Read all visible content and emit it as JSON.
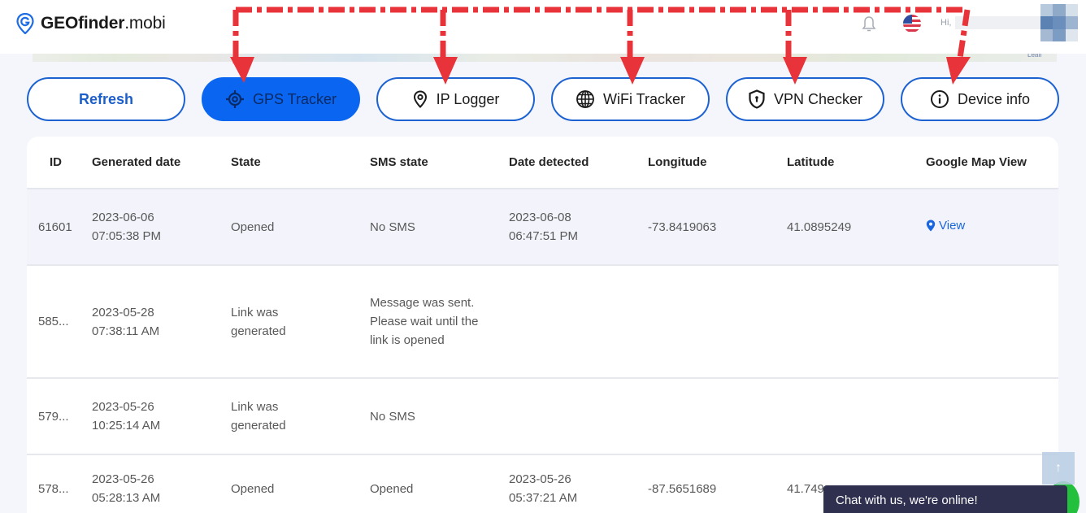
{
  "header": {
    "logo_bold": "GEOfinder",
    "logo_light": ".mobi",
    "greeting": "Hi,",
    "icons": [
      "location-pin-logo-icon",
      "bell-icon",
      "us-flag-icon",
      "avatar"
    ]
  },
  "map_attribution": "Leafl",
  "tabs": [
    {
      "label": "Refresh",
      "icon": null,
      "active": false
    },
    {
      "label": "GPS Tracker",
      "icon": "crosshair-icon",
      "active": true
    },
    {
      "label": "IP Logger",
      "icon": "location-pin-icon",
      "active": false
    },
    {
      "label": "WiFi Tracker",
      "icon": "globe-icon",
      "active": false
    },
    {
      "label": "VPN Checker",
      "icon": "shield-icon",
      "active": false
    },
    {
      "label": "Device info",
      "icon": "info-icon",
      "active": false
    }
  ],
  "table": {
    "columns": [
      "ID",
      "Generated date",
      "State",
      "SMS state",
      "Date detected",
      "Longitude",
      "Latitude",
      "Google Map View"
    ],
    "rows": [
      {
        "id": "61601",
        "generated_date": "2023-06-06",
        "generated_time": "07:05:38 PM",
        "state": "Opened",
        "sms_state": "No SMS",
        "detected_date": "2023-06-08",
        "detected_time": "06:47:51 PM",
        "longitude": "-73.8419063",
        "latitude": "41.0895249",
        "map_view": "View"
      },
      {
        "id": "585...",
        "generated_date": "2023-05-28",
        "generated_time": "07:38:11 AM",
        "state": "Link was generated",
        "sms_state": "Message was sent. Please wait until the link is opened",
        "detected_date": "",
        "detected_time": "",
        "longitude": "",
        "latitude": "",
        "map_view": ""
      },
      {
        "id": "579...",
        "generated_date": "2023-05-26",
        "generated_time": "10:25:14 AM",
        "state": "Link was generated",
        "sms_state": "No SMS",
        "detected_date": "",
        "detected_time": "",
        "longitude": "",
        "latitude": "",
        "map_view": ""
      },
      {
        "id": "578...",
        "generated_date": "2023-05-26",
        "generated_time": "05:28:13 AM",
        "state": "Opened",
        "sms_state": "Opened",
        "detected_date": "2023-05-26",
        "detected_time": "05:37:21 AM",
        "longitude": "-87.5651689",
        "latitude": "41.749",
        "map_view": ""
      }
    ]
  },
  "chat_widget": {
    "text": "Chat with us, we're online!"
  },
  "scroll_top": {
    "icon": "arrow-up-icon",
    "glyph": "↑"
  },
  "colors": {
    "accent": "#0a66f0",
    "border_blue": "#1d62d1",
    "annotation_red": "#e8333a",
    "chat_bg": "#2f3050",
    "online_green": "#22c03c"
  }
}
